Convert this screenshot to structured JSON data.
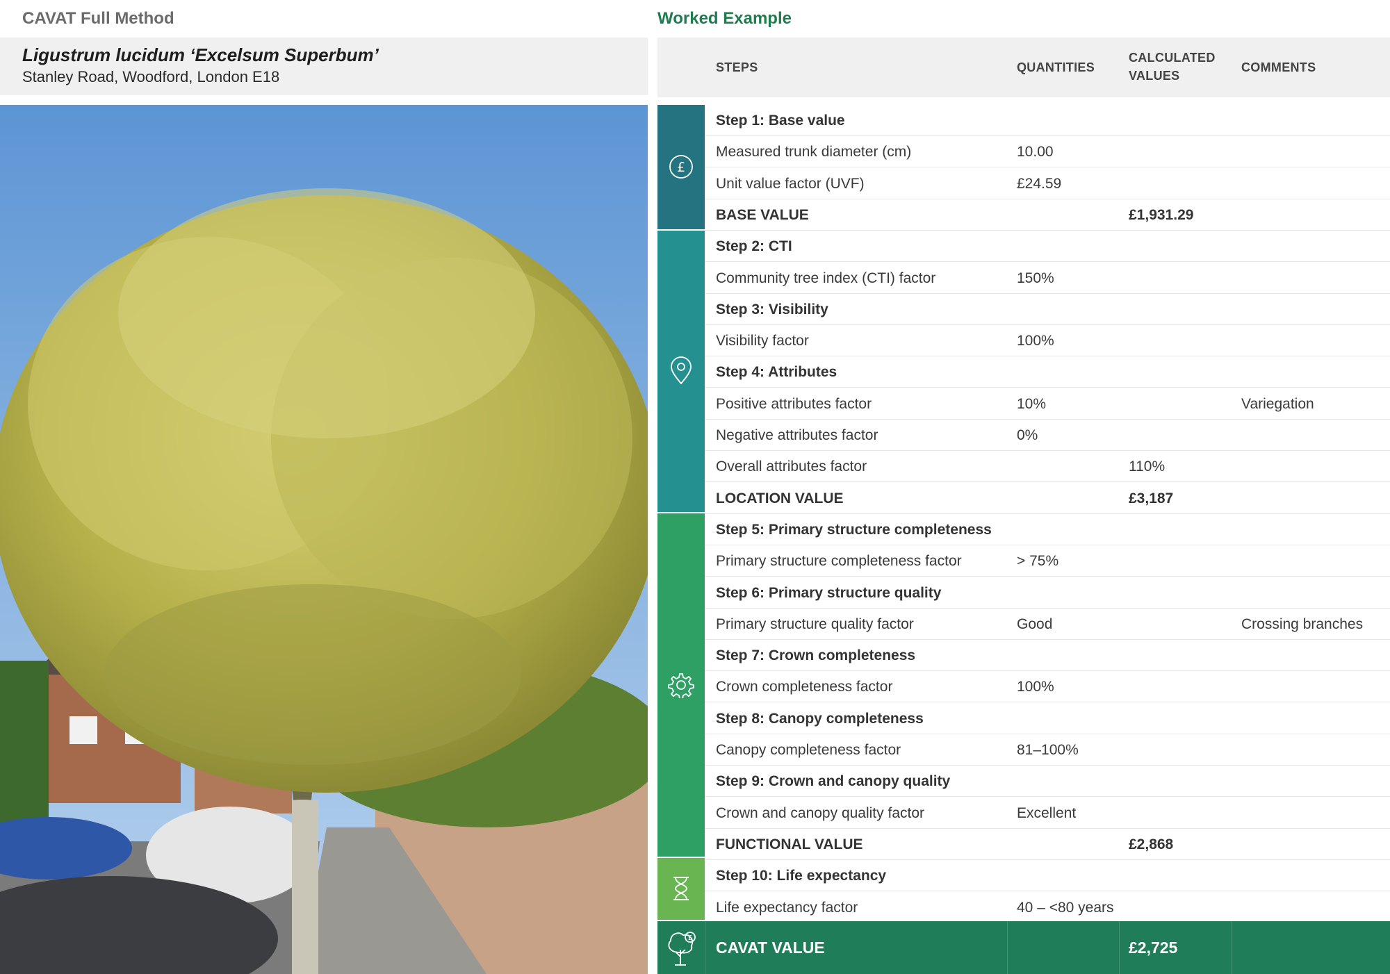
{
  "header": {
    "left_title": "CAVAT Full Method",
    "right_title": "Worked Example"
  },
  "tree": {
    "name": "Ligustrum lucidum ‘Excelsum Superbum’",
    "address": "Stanley Road, Woodford, London E18"
  },
  "columns": {
    "steps": "STEPS",
    "quantities": "QUANTITIES",
    "calculated_line1": "CALCULATED",
    "calculated_line2": "VALUES",
    "comments": "COMMENTS"
  },
  "rows": [
    {
      "step": "Step 1: Base value",
      "qty": "",
      "calc": "",
      "comment": "",
      "bold": true
    },
    {
      "step": "Measured trunk diameter (cm)",
      "qty": "10.00",
      "calc": "",
      "comment": "",
      "bold": false
    },
    {
      "step": "Unit value factor (UVF)",
      "qty": "£24.59",
      "calc": "",
      "comment": "",
      "bold": false
    },
    {
      "step": "BASE VALUE",
      "qty": "",
      "calc": "£1,931.29",
      "comment": "",
      "bold": true
    },
    {
      "step": "Step 2: CTI",
      "qty": "",
      "calc": "",
      "comment": "",
      "bold": true
    },
    {
      "step": "Community tree index (CTI) factor",
      "qty": "150%",
      "calc": "",
      "comment": "",
      "bold": false
    },
    {
      "step": "Step 3: Visibility",
      "qty": "",
      "calc": "",
      "comment": "",
      "bold": true
    },
    {
      "step": "Visibility factor",
      "qty": "100%",
      "calc": "",
      "comment": "",
      "bold": false
    },
    {
      "step": "Step 4: Attributes",
      "qty": "",
      "calc": "",
      "comment": "",
      "bold": true
    },
    {
      "step": "Positive attributes factor",
      "qty": "10%",
      "calc": "",
      "comment": "Variegation",
      "bold": false
    },
    {
      "step": "Negative attributes factor",
      "qty": "0%",
      "calc": "",
      "comment": "",
      "bold": false
    },
    {
      "step": "Overall attributes factor",
      "qty": "",
      "calc": "110%",
      "comment": "",
      "bold": false
    },
    {
      "step": "LOCATION VALUE",
      "qty": "",
      "calc": "£3,187",
      "comment": "",
      "bold": true
    },
    {
      "step": "Step 5: Primary structure completeness",
      "qty": "",
      "calc": "",
      "comment": "",
      "bold": true
    },
    {
      "step": "Primary structure completeness factor",
      "qty": "> 75%",
      "calc": "",
      "comment": "",
      "bold": false
    },
    {
      "step": "Step 6: Primary structure quality",
      "qty": "",
      "calc": "",
      "comment": "",
      "bold": true
    },
    {
      "step": "Primary structure quality factor",
      "qty": "Good",
      "calc": "",
      "comment": "Crossing branches",
      "bold": false
    },
    {
      "step": "Step 7: Crown completeness",
      "qty": "",
      "calc": "",
      "comment": "",
      "bold": true
    },
    {
      "step": "Crown completeness factor",
      "qty": "100%",
      "calc": "",
      "comment": "",
      "bold": false
    },
    {
      "step": "Step 8: Canopy completeness",
      "qty": "",
      "calc": "",
      "comment": "",
      "bold": true
    },
    {
      "step": "Canopy completeness factor",
      "qty": "81–100%",
      "calc": "",
      "comment": "",
      "bold": false
    },
    {
      "step": "Step 9: Crown and canopy quality",
      "qty": "",
      "calc": "",
      "comment": "",
      "bold": true
    },
    {
      "step": "Crown and canopy quality factor",
      "qty": "Excellent",
      "calc": "",
      "comment": "",
      "bold": false
    },
    {
      "step": "FUNCTIONAL VALUE",
      "qty": "",
      "calc": "£2,868",
      "comment": "",
      "bold": true
    },
    {
      "step": "Step 10: Life expectancy",
      "qty": "",
      "calc": "",
      "comment": "",
      "bold": true
    },
    {
      "step": "Life expectancy factor",
      "qty": "40 – <80 years",
      "calc": "",
      "comment": "",
      "bold": false
    }
  ],
  "total": {
    "label": "CAVAT VALUE",
    "value": "£2,725"
  },
  "bands": [
    {
      "icon": "pound-coin-icon",
      "color": "#237480"
    },
    {
      "icon": "location-pin-icon",
      "color": "#249190"
    },
    {
      "icon": "gear-icon",
      "color": "#2ea063"
    },
    {
      "icon": "hourglass-icon",
      "color": "#68b552"
    },
    {
      "icon": "tree-value-icon",
      "color": "#1f7d5a"
    }
  ]
}
